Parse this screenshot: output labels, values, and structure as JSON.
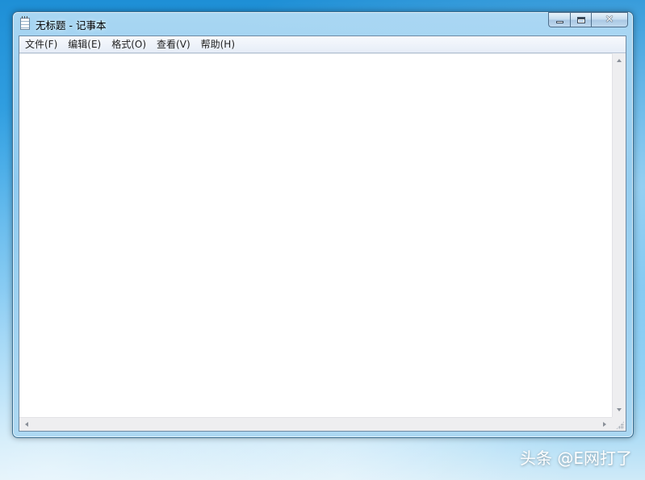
{
  "window": {
    "title": "无标题 - 记事本",
    "icon": "notepad-icon",
    "caption_buttons": {
      "minimize": "minimize-icon",
      "maximize": "maximize-icon",
      "close": "close-icon",
      "close_glyph": "✕"
    }
  },
  "menu": {
    "items": [
      {
        "label": "文件(F)"
      },
      {
        "label": "编辑(E)"
      },
      {
        "label": "格式(O)"
      },
      {
        "label": "查看(V)"
      },
      {
        "label": "帮助(H)"
      }
    ]
  },
  "editor": {
    "content": ""
  },
  "watermark": {
    "text": "头条 @E网打了"
  },
  "colors": {
    "desktop": "#3aa6e6",
    "window_frame": "#a9d3f0",
    "menubar": "#eef2f9",
    "editor_bg": "#ffffff",
    "scrollbar": "#eeeef0"
  }
}
